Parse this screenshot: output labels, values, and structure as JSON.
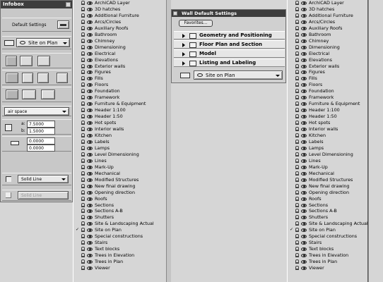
{
  "infobox": {
    "title": "Infobox",
    "default_settings": "Default Settings",
    "layer_label": "Site on Plan",
    "material": "air space",
    "value_a": "7.5000",
    "value_b": "1.5000",
    "value_c": "0.0000",
    "value_d": "0.0000",
    "line1": "Solid Line",
    "line2": "Solid Line",
    "label_a": "a:",
    "label_b": "b:"
  },
  "layers": [
    {
      "name": "ArchiCAD Layer",
      "checked": false
    },
    {
      "name": "3D hatches",
      "checked": false
    },
    {
      "name": "Additional Furniture",
      "checked": false
    },
    {
      "name": "Arcs/Circles",
      "checked": false
    },
    {
      "name": "Auxiliary Roofs",
      "checked": false
    },
    {
      "name": "Bathroom",
      "checked": false
    },
    {
      "name": "Chimney",
      "checked": false
    },
    {
      "name": "Dimensioning",
      "checked": false
    },
    {
      "name": "Electrical",
      "checked": false
    },
    {
      "name": "Elevations",
      "checked": false
    },
    {
      "name": "Exterior walls",
      "checked": false
    },
    {
      "name": "Figures",
      "checked": false
    },
    {
      "name": "Fills",
      "checked": false
    },
    {
      "name": "Floors",
      "checked": false
    },
    {
      "name": "Foundation",
      "checked": false
    },
    {
      "name": "Framework",
      "checked": false
    },
    {
      "name": "Furniture & Equipment",
      "checked": false
    },
    {
      "name": "Header 1:100",
      "checked": false
    },
    {
      "name": "Header 1:50",
      "checked": false
    },
    {
      "name": "Hot spots",
      "checked": false
    },
    {
      "name": "Interior walls",
      "checked": false
    },
    {
      "name": "Kitchen",
      "checked": false
    },
    {
      "name": "Labels",
      "checked": false
    },
    {
      "name": "Lamps",
      "checked": false
    },
    {
      "name": "Level Dimensioning",
      "checked": false
    },
    {
      "name": "Lines",
      "checked": false
    },
    {
      "name": "Mark-Up",
      "checked": false
    },
    {
      "name": "Mechanical",
      "checked": false
    },
    {
      "name": "Modified Structures",
      "checked": false
    },
    {
      "name": "New final drawing",
      "checked": false
    },
    {
      "name": "Opening direction",
      "checked": false
    },
    {
      "name": "Roofs",
      "checked": false
    },
    {
      "name": "Sections",
      "checked": false
    },
    {
      "name": "Sections A-B",
      "checked": false
    },
    {
      "name": "Shutters",
      "checked": false
    },
    {
      "name": "Site & Landscaping Actual",
      "checked": false
    },
    {
      "name": "Site on Plan",
      "checked": true
    },
    {
      "name": "Special constructions",
      "checked": false
    },
    {
      "name": "Stairs",
      "checked": false
    },
    {
      "name": "Text blocks",
      "checked": false
    },
    {
      "name": "Trees in Elevation",
      "checked": false
    },
    {
      "name": "Trees in Plan",
      "checked": false
    },
    {
      "name": "Viewer",
      "checked": false
    }
  ],
  "wall_dialog": {
    "title": "Wall Default Settings",
    "favorites": "Favorites...",
    "sections": [
      "Geometry and Positioning",
      "Floor Plan and Section",
      "Model",
      "Listing and Labeling"
    ],
    "layer_label": "Site on Plan"
  }
}
